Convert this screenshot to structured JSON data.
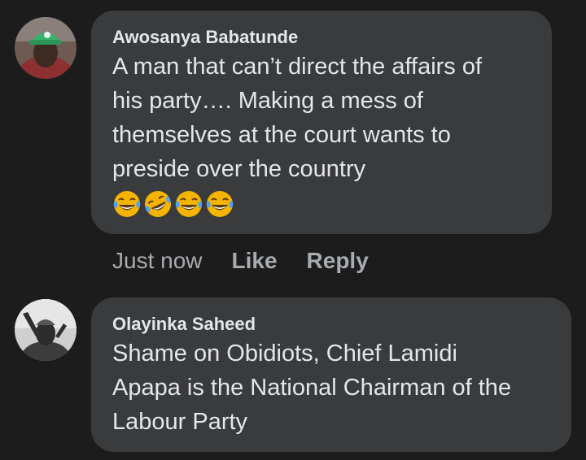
{
  "comments": [
    {
      "author": "Awosanya Babatunde",
      "text_lines": [
        "A man that can’t direct the affairs of",
        "his party…. Making a mess of",
        "themselves at the court wants to",
        "preside over the country"
      ],
      "reactions": [
        "face-with-tears-of-joy-icon",
        "rolling-on-floor-laughing-icon",
        "face-with-tears-of-joy-icon",
        "face-with-tears-of-joy-icon"
      ],
      "timestamp": "Just now",
      "actions": {
        "like": "Like",
        "reply": "Reply"
      }
    },
    {
      "author": "Olayinka Saheed",
      "text_lines": [
        "Shame on Obidiots, Chief Lamidi",
        "Apapa is the National Chairman of the",
        "Labour Party"
      ]
    }
  ],
  "colors": {
    "background": "#1c1c1d",
    "bubble": "#3a3b3c",
    "text": "#e4e6eb",
    "muted": "#a8abaf"
  }
}
